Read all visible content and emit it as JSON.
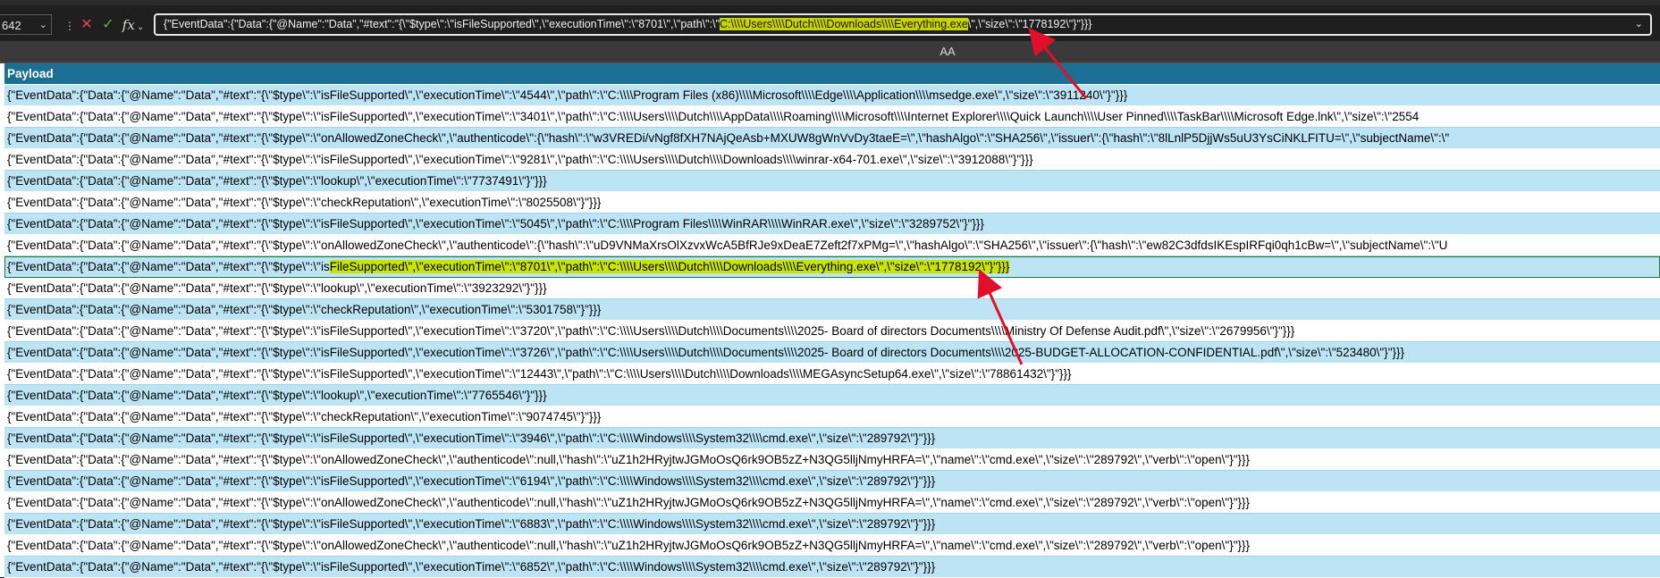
{
  "formula_bar": {
    "name_box": "642",
    "formula_prefix": "{\"EventData\":{\"Data\":{\"@Name\":\"Data\",\"#text\":\"{\\\"$type\\\":\\\"isFileSupported\\\",\\\"executionTime\\\":\\\"8701\\\",\\\"path\\\":\\\"",
    "formula_highlight": "C:\\\\\\\\Users\\\\\\\\Dutch\\\\\\\\Downloads\\\\\\\\Everything.exe",
    "formula_suffix": "\\\",\\\"size\\\":\\\"1778192\\\"}\"}}}"
  },
  "column_header": "AA",
  "table": {
    "header": "Payload",
    "rows": [
      "{\"EventData\":{\"Data\":{\"@Name\":\"Data\",\"#text\":\"{\\\"$type\\\":\\\"isFileSupported\\\",\\\"executionTime\\\":\\\"4544\\\",\\\"path\\\":\\\"C:\\\\\\\\Program Files (x86)\\\\\\\\Microsoft\\\\\\\\Edge\\\\\\\\Application\\\\\\\\msedge.exe\\\",\\\"size\\\":\\\"3911240\\\"}\"}}}",
      "{\"EventData\":{\"Data\":{\"@Name\":\"Data\",\"#text\":\"{\\\"$type\\\":\\\"isFileSupported\\\",\\\"executionTime\\\":\\\"3401\\\",\\\"path\\\":\\\"C:\\\\\\\\Users\\\\\\\\Dutch\\\\\\\\AppData\\\\\\\\Roaming\\\\\\\\Microsoft\\\\\\\\Internet Explorer\\\\\\\\Quick Launch\\\\\\\\User Pinned\\\\\\\\TaskBar\\\\\\\\Microsoft Edge.lnk\\\",\\\"size\\\":\\\"2554",
      "{\"EventData\":{\"Data\":{\"@Name\":\"Data\",\"#text\":\"{\\\"$type\\\":\\\"onAllowedZoneCheck\\\",\\\"authenticode\\\":{\\\"hash\\\":\\\"w3VREDi/vNgf8fXH7NAjQeAsb+MXUW8gWnVvDy3taeE=\\\",\\\"hashAlgo\\\":\\\"SHA256\\\",\\\"issuer\\\":{\\\"hash\\\":\\\"8lLnlP5DjjWs5uU3YsCiNKLFITU=\\\",\\\"subjectName\\\":\\\"",
      "{\"EventData\":{\"Data\":{\"@Name\":\"Data\",\"#text\":\"{\\\"$type\\\":\\\"isFileSupported\\\",\\\"executionTime\\\":\\\"9281\\\",\\\"path\\\":\\\"C:\\\\\\\\Users\\\\\\\\Dutch\\\\\\\\Downloads\\\\\\\\winrar-x64-701.exe\\\",\\\"size\\\":\\\"3912088\\\"}\"}}}",
      "{\"EventData\":{\"Data\":{\"@Name\":\"Data\",\"#text\":\"{\\\"$type\\\":\\\"lookup\\\",\\\"executionTime\\\":\\\"7737491\\\"}\"}}}",
      "{\"EventData\":{\"Data\":{\"@Name\":\"Data\",\"#text\":\"{\\\"$type\\\":\\\"checkReputation\\\",\\\"executionTime\\\":\\\"8025508\\\"}\"}}}",
      "{\"EventData\":{\"Data\":{\"@Name\":\"Data\",\"#text\":\"{\\\"$type\\\":\\\"isFileSupported\\\",\\\"executionTime\\\":\\\"5045\\\",\\\"path\\\":\\\"C:\\\\\\\\Program Files\\\\\\\\WinRAR\\\\\\\\WinRAR.exe\\\",\\\"size\\\":\\\"3289752\\\"}\"}}}",
      "{\"EventData\":{\"Data\":{\"@Name\":\"Data\",\"#text\":\"{\\\"$type\\\":\\\"onAllowedZoneCheck\\\",\\\"authenticode\\\":{\\\"hash\\\":\\\"uD9VNMaXrsOlXzvxWcA5BfRJe9xDeaE7Zeft2f7xPMg=\\\",\\\"hashAlgo\\\":\\\"SHA256\\\",\\\"issuer\\\":{\\\"hash\\\":\\\"ew82C3dfdsIKEspIRFqi0qh1cBw=\\\",\\\"subjectName\\\":\\\"U",
      "{\"EventData\":{\"Data\":{\"@Name\":\"Data\",\"#text\":\"{\\\"$type\\\":\\\"isFileSupported\\\",\\\"executionTime\\\":\\\"8701\\\",\\\"path\\\":\\\"C:\\\\\\\\Users\\\\\\\\Dutch\\\\\\\\Downloads\\\\\\\\Everything.exe\\\",\\\"size\\\":\\\"1778192\\\"}\"}}}",
      "{\"EventData\":{\"Data\":{\"@Name\":\"Data\",\"#text\":\"{\\\"$type\\\":\\\"lookup\\\",\\\"executionTime\\\":\\\"3923292\\\"}\"}}}",
      "{\"EventData\":{\"Data\":{\"@Name\":\"Data\",\"#text\":\"{\\\"$type\\\":\\\"checkReputation\\\",\\\"executionTime\\\":\\\"5301758\\\"}\"}}}",
      "{\"EventData\":{\"Data\":{\"@Name\":\"Data\",\"#text\":\"{\\\"$type\\\":\\\"isFileSupported\\\",\\\"executionTime\\\":\\\"3720\\\",\\\"path\\\":\\\"C:\\\\\\\\Users\\\\\\\\Dutch\\\\\\\\Documents\\\\\\\\2025- Board of directors Documents\\\\\\\\Ministry Of Defense Audit.pdf\\\",\\\"size\\\":\\\"2679956\\\"}\"}}}",
      "{\"EventData\":{\"Data\":{\"@Name\":\"Data\",\"#text\":\"{\\\"$type\\\":\\\"isFileSupported\\\",\\\"executionTime\\\":\\\"3726\\\",\\\"path\\\":\\\"C:\\\\\\\\Users\\\\\\\\Dutch\\\\\\\\Documents\\\\\\\\2025- Board of directors Documents\\\\\\\\2025-BUDGET-ALLOCATION-CONFIDENTIAL.pdf\\\",\\\"size\\\":\\\"523480\\\"}\"}}}",
      "{\"EventData\":{\"Data\":{\"@Name\":\"Data\",\"#text\":\"{\\\"$type\\\":\\\"isFileSupported\\\",\\\"executionTime\\\":\\\"12443\\\",\\\"path\\\":\\\"C:\\\\\\\\Users\\\\\\\\Dutch\\\\\\\\Downloads\\\\\\\\MEGAsyncSetup64.exe\\\",\\\"size\\\":\\\"78861432\\\"}\"}}}",
      "{\"EventData\":{\"Data\":{\"@Name\":\"Data\",\"#text\":\"{\\\"$type\\\":\\\"lookup\\\",\\\"executionTime\\\":\\\"7765546\\\"}\"}}}",
      "{\"EventData\":{\"Data\":{\"@Name\":\"Data\",\"#text\":\"{\\\"$type\\\":\\\"checkReputation\\\",\\\"executionTime\\\":\\\"9074745\\\"}\"}}}",
      "{\"EventData\":{\"Data\":{\"@Name\":\"Data\",\"#text\":\"{\\\"$type\\\":\\\"isFileSupported\\\",\\\"executionTime\\\":\\\"3946\\\",\\\"path\\\":\\\"C:\\\\\\\\Windows\\\\\\\\System32\\\\\\\\cmd.exe\\\",\\\"size\\\":\\\"289792\\\"}\"}}}",
      "{\"EventData\":{\"Data\":{\"@Name\":\"Data\",\"#text\":\"{\\\"$type\\\":\\\"onAllowedZoneCheck\\\",\\\"authenticode\\\":null,\\\"hash\\\":\\\"uZ1h2HRyjtwJGMoOsQ6rk9OB5zZ+N3QG5lljNmyHRFA=\\\",\\\"name\\\":\\\"cmd.exe\\\",\\\"size\\\":\\\"289792\\\",\\\"verb\\\":\\\"open\\\"}\"}}}",
      "{\"EventData\":{\"Data\":{\"@Name\":\"Data\",\"#text\":\"{\\\"$type\\\":\\\"isFileSupported\\\",\\\"executionTime\\\":\\\"6194\\\",\\\"path\\\":\\\"C:\\\\\\\\Windows\\\\\\\\System32\\\\\\\\cmd.exe\\\",\\\"size\\\":\\\"289792\\\"}\"}}}",
      "{\"EventData\":{\"Data\":{\"@Name\":\"Data\",\"#text\":\"{\\\"$type\\\":\\\"onAllowedZoneCheck\\\",\\\"authenticode\\\":null,\\\"hash\\\":\\\"uZ1h2HRyjtwJGMoOsQ6rk9OB5zZ+N3QG5lljNmyHRFA=\\\",\\\"name\\\":\\\"cmd.exe\\\",\\\"size\\\":\\\"289792\\\",\\\"verb\\\":\\\"open\\\"}\"}}}",
      "{\"EventData\":{\"Data\":{\"@Name\":\"Data\",\"#text\":\"{\\\"$type\\\":\\\"isFileSupported\\\",\\\"executionTime\\\":\\\"6883\\\",\\\"path\\\":\\\"C:\\\\\\\\Windows\\\\\\\\System32\\\\\\\\cmd.exe\\\",\\\"size\\\":\\\"289792\\\"}\"}}}",
      "{\"EventData\":{\"Data\":{\"@Name\":\"Data\",\"#text\":\"{\\\"$type\\\":\\\"onAllowedZoneCheck\\\",\\\"authenticode\\\":null,\\\"hash\\\":\\\"uZ1h2HRyjtwJGMoOsQ6rk9OB5zZ+N3QG5lljNmyHRFA=\\\",\\\"name\\\":\\\"cmd.exe\\\",\\\"size\\\":\\\"289792\\\",\\\"verb\\\":\\\"open\\\"}\"}}}",
      "{\"EventData\":{\"Data\":{\"@Name\":\"Data\",\"#text\":\"{\\\"$type\\\":\\\"isFileSupported\\\",\\\"executionTime\\\":\\\"6852\\\",\\\"path\\\":\\\"C:\\\\\\\\Windows\\\\\\\\System32\\\\\\\\cmd.exe\\\",\\\"size\\\":\\\"289792\\\"}\"}}}"
    ],
    "active_row_plain": "{\"EventData\":{\"Data\":{\"@Name\":\"Data\",\"#text\":\"{\\\"$type\\\":\\\"is",
    "active_row_highlight": "FileSupported\\\",\\\"executionTime\\\":\\\"8701\\\",\\\"path\\\":\\\"C:\\\\\\\\Users\\\\\\\\Dutch\\\\\\\\Downloads\\\\\\\\Everything.exe\\\",\\\"size\\\":\\\"1778192\\\"}\"}}}"
  },
  "colors": {
    "highlight": "#c8e400",
    "arrow": "#e0102a",
    "header_bg": "#1b6f92",
    "band_bg": "#bde4f4"
  }
}
